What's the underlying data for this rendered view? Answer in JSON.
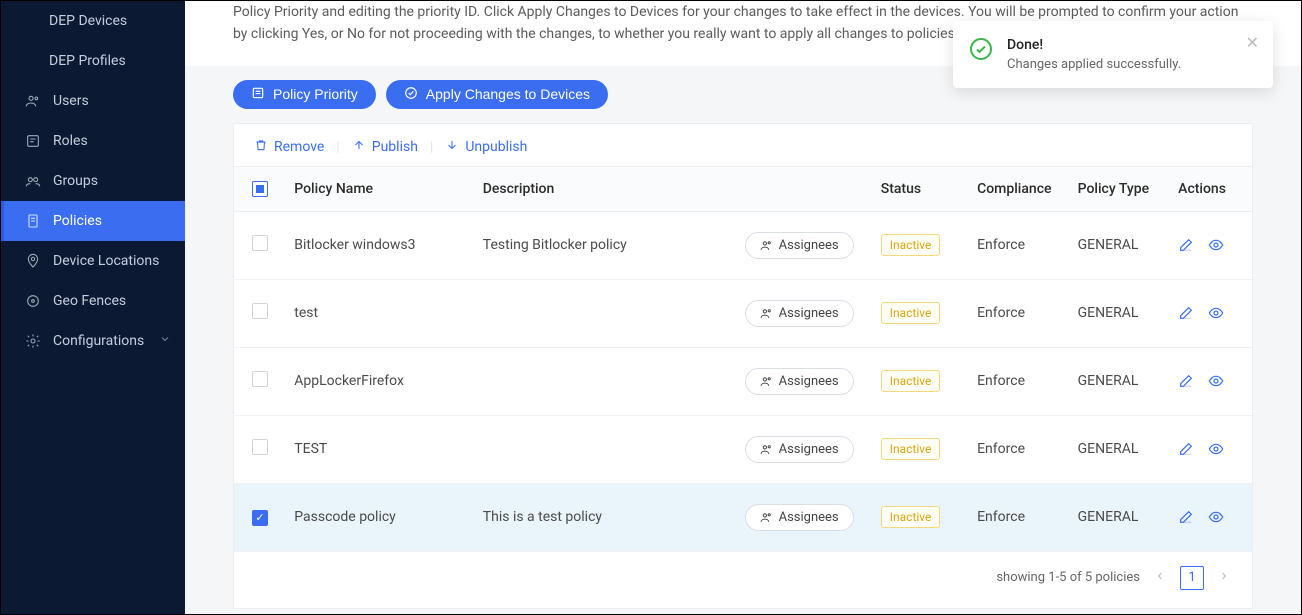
{
  "sidebar": {
    "items": [
      {
        "label": "DEP Devices",
        "icon": null,
        "sub": true
      },
      {
        "label": "DEP Profiles",
        "icon": null,
        "sub": true
      },
      {
        "label": "Users",
        "icon": "users"
      },
      {
        "label": "Roles",
        "icon": "roles"
      },
      {
        "label": "Groups",
        "icon": "groups"
      },
      {
        "label": "Policies",
        "icon": "policies",
        "active": true
      },
      {
        "label": "Device Locations",
        "icon": "location"
      },
      {
        "label": "Geo Fences",
        "icon": "geofence"
      },
      {
        "label": "Configurations",
        "icon": "gear",
        "expandable": true
      }
    ]
  },
  "header": {
    "description": "Policy Priority and editing the priority ID. Click Apply Changes to Devices for your changes to take effect in the devices. You will be prompted to confirm your action by clicking Yes, or No for not proceeding with the changes, to whether you really want to apply all changes to policies."
  },
  "toolbar": {
    "policy_priority": "Policy Priority",
    "apply_changes": "Apply Changes to Devices"
  },
  "table": {
    "actions": {
      "remove": "Remove",
      "publish": "Publish",
      "unpublish": "Unpublish"
    },
    "columns": {
      "name": "Policy Name",
      "description": "Description",
      "assignees_hidden": "",
      "status": "Status",
      "compliance": "Compliance",
      "type": "Policy Type",
      "actions": "Actions"
    },
    "assignees_label": "Assignees",
    "rows": [
      {
        "name": "Bitlocker windows3",
        "description": "Testing Bitlocker policy",
        "status": "Inactive",
        "compliance": "Enforce",
        "type": "GENERAL",
        "selected": false
      },
      {
        "name": "test",
        "description": "",
        "status": "Inactive",
        "compliance": "Enforce",
        "type": "GENERAL",
        "selected": false
      },
      {
        "name": "AppLockerFirefox",
        "description": "",
        "status": "Inactive",
        "compliance": "Enforce",
        "type": "GENERAL",
        "selected": false
      },
      {
        "name": "TEST",
        "description": "",
        "status": "Inactive",
        "compliance": "Enforce",
        "type": "GENERAL",
        "selected": false
      },
      {
        "name": "Passcode policy",
        "description": "This is a test policy",
        "status": "Inactive",
        "compliance": "Enforce",
        "type": "GENERAL",
        "selected": true
      }
    ],
    "header_select_state": "indeterminate"
  },
  "pagination": {
    "text": "showing 1-5 of 5 policies",
    "current": "1"
  },
  "toast": {
    "title": "Done!",
    "message": "Changes applied successfully."
  }
}
